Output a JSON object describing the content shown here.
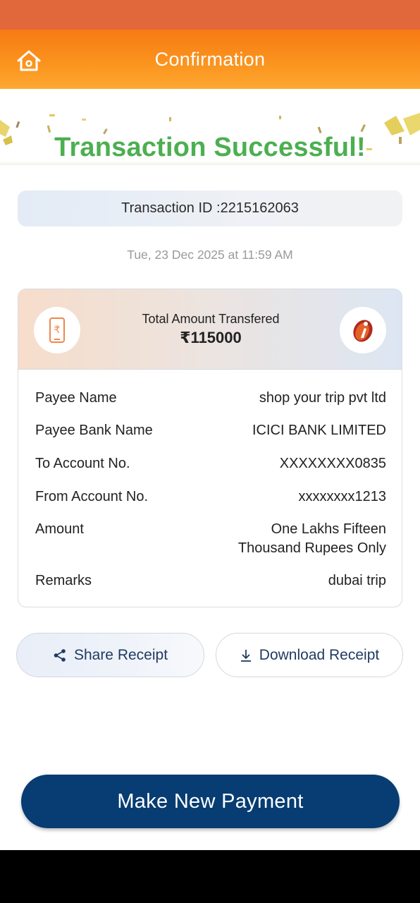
{
  "header": {
    "title": "Confirmation",
    "home_icon": "home-icon",
    "status_bar_color": "#e0683a",
    "gradient_colors": [
      "#f77a14",
      "#fda833"
    ]
  },
  "success": {
    "title": "Transaction Successful!",
    "color": "#4caf50"
  },
  "transaction": {
    "id_text": "Transaction ID :2215162063",
    "datetime": "Tue, 23 Dec 2025 at 11:59 AM"
  },
  "amount_card": {
    "label": "Total Amount Transfered",
    "amount": "₹115000",
    "left_icon": "rupee-phone-icon",
    "right_icon": "icici-bank-logo"
  },
  "details": [
    {
      "label": "Payee Name",
      "value": "shop your trip pvt ltd"
    },
    {
      "label": "Payee Bank Name",
      "value": "ICICI BANK LIMITED"
    },
    {
      "label": "To Account No.",
      "value": "XXXXXXXX0835"
    },
    {
      "label": "From Account No.",
      "value": "xxxxxxxx1213"
    },
    {
      "label": "Amount",
      "value_line1": "One Lakhs Fifteen",
      "value_line2": "Thousand Rupees Only"
    },
    {
      "label": "Remarks",
      "value": "dubai trip"
    }
  ],
  "actions": {
    "share_label": "Share Receipt",
    "share_icon": "share-icon",
    "download_label": "Download Receipt",
    "download_icon": "download-icon"
  },
  "primary": {
    "label": "Make New Payment",
    "color": "#073d72"
  }
}
